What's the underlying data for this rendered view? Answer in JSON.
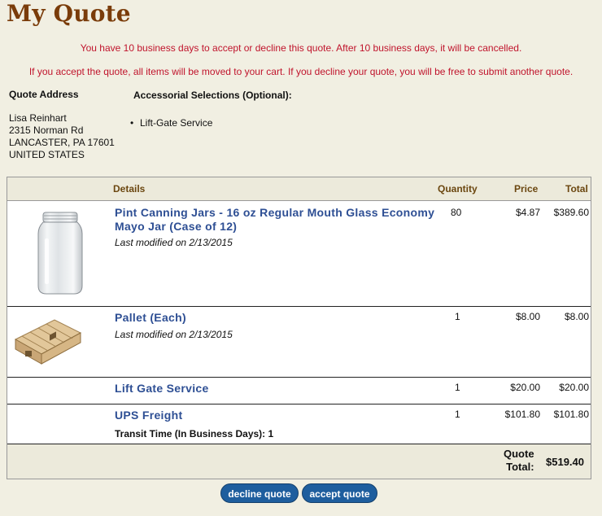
{
  "page": {
    "title": "My Quote",
    "notice1": "You have 10 business days to accept or decline this quote. After 10 business days, it will be cancelled.",
    "notice2": "If you accept the quote, all items will be moved to your cart. If you decline your quote, you will be free to submit another quote."
  },
  "address": {
    "heading": "Quote Address",
    "lines": [
      "Lisa Reinhart",
      "2315 Norman Rd",
      "LANCASTER, PA 17601",
      "UNITED STATES"
    ]
  },
  "accessorials": {
    "heading": "Accessorial Selections (Optional):",
    "items": [
      "Lift-Gate Service"
    ]
  },
  "table": {
    "headers": {
      "details": "Details",
      "quantity": "Quantity",
      "price": "Price",
      "total": "Total"
    },
    "rows": [
      {
        "name": "Pint Canning Jars - 16 oz Regular Mouth Glass Economy Mayo Jar (Case of 12)",
        "modified": "Last modified on 2/13/2015",
        "quantity": "80",
        "price": "$4.87",
        "total": "$389.60",
        "image": "mason-jar"
      },
      {
        "name": "Pallet (Each)",
        "modified": "Last modified on 2/13/2015",
        "quantity": "1",
        "price": "$8.00",
        "total": "$8.00",
        "image": "wood-pallet"
      },
      {
        "name": "Lift Gate Service",
        "quantity": "1",
        "price": "$20.00",
        "total": "$20.00"
      },
      {
        "name": "UPS Freight",
        "transit_label": "Transit Time (In Business Days): 1",
        "quantity": "1",
        "price": "$101.80",
        "total": "$101.80"
      }
    ],
    "footer": {
      "label_line1": "Quote",
      "label_line2": "Total:",
      "value": "$519.40"
    }
  },
  "actions": {
    "decline": "decline quote",
    "accept": "accept quote"
  }
}
